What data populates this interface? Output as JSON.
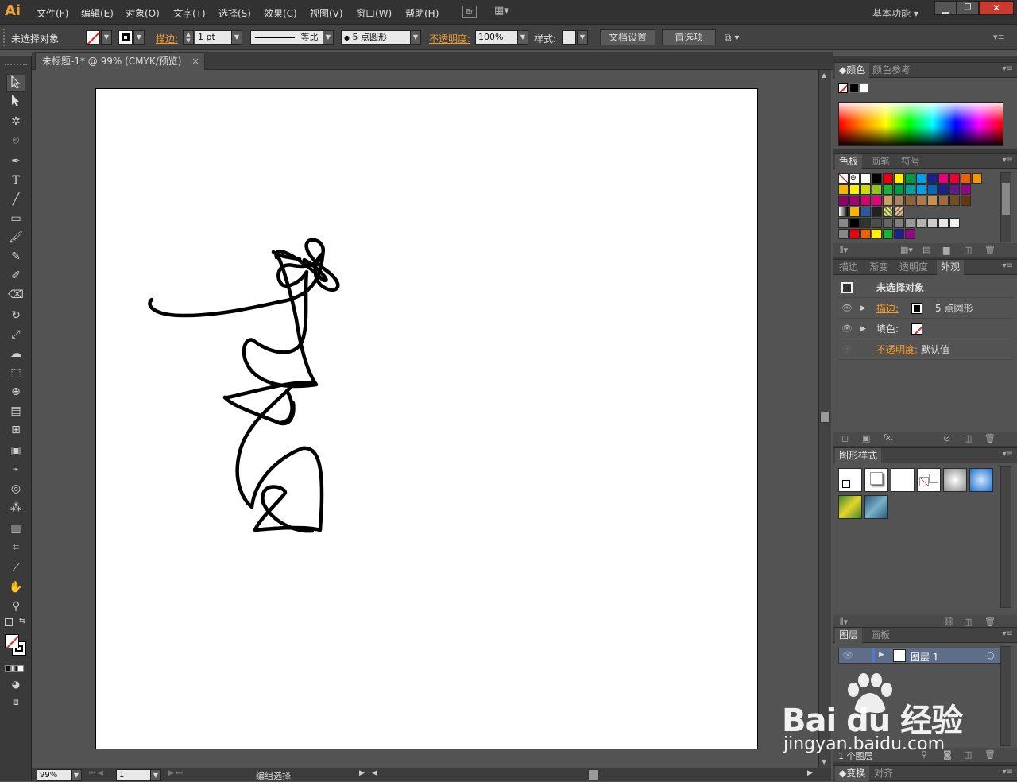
{
  "app": {
    "logo": "Ai",
    "menus": [
      "文件(F)",
      "编辑(E)",
      "对象(O)",
      "文字(T)",
      "选择(S)",
      "效果(C)",
      "视图(V)",
      "窗口(W)",
      "帮助(H)"
    ],
    "bridge_label": "Br",
    "workspace": "基本功能"
  },
  "control": {
    "selection": "未选择对象",
    "stroke_label": "描边:",
    "stroke_weight": "1 pt",
    "profile": "等比",
    "brush": "5 点圆形",
    "opacity_label": "不透明度:",
    "opacity": "100%",
    "style_label": "样式:",
    "doc_setup": "文档设置",
    "prefs": "首选项"
  },
  "document": {
    "tab_title": "未标题-1* @ 99% (CMYK/预览)",
    "close": "×"
  },
  "status": {
    "zoom": "99%",
    "page": "1",
    "mode": "编组选择"
  },
  "panels": {
    "color": {
      "tabs": [
        "颜色",
        "颜色参考"
      ]
    },
    "swatches": {
      "tabs": [
        "色板",
        "画笔",
        "符号"
      ]
    },
    "appearance": {
      "tabs": [
        "描边",
        "渐变",
        "透明度",
        "外观"
      ],
      "title": "未选择对象",
      "stroke_label": "描边:",
      "stroke_value": "5 点圆形",
      "fill_label": "填色:",
      "opacity_label": "不透明度:",
      "opacity_value": "默认值",
      "fx": "fx."
    },
    "graphic_styles": {
      "tabs": [
        "图形样式"
      ]
    },
    "layers": {
      "tabs": [
        "图层",
        "画板"
      ],
      "layer_name": "图层 1",
      "count": "1 个图层"
    },
    "transform": {
      "tabs": [
        "变换",
        "对齐"
      ]
    }
  },
  "watermark": {
    "brand": "Bai du 经验",
    "url": "jingyan.baidu.com"
  },
  "colors": {
    "accent": "#f39a2c",
    "ui_dark": "#323232",
    "canvas_bg": "#535353",
    "artboard": "#ffffff"
  }
}
